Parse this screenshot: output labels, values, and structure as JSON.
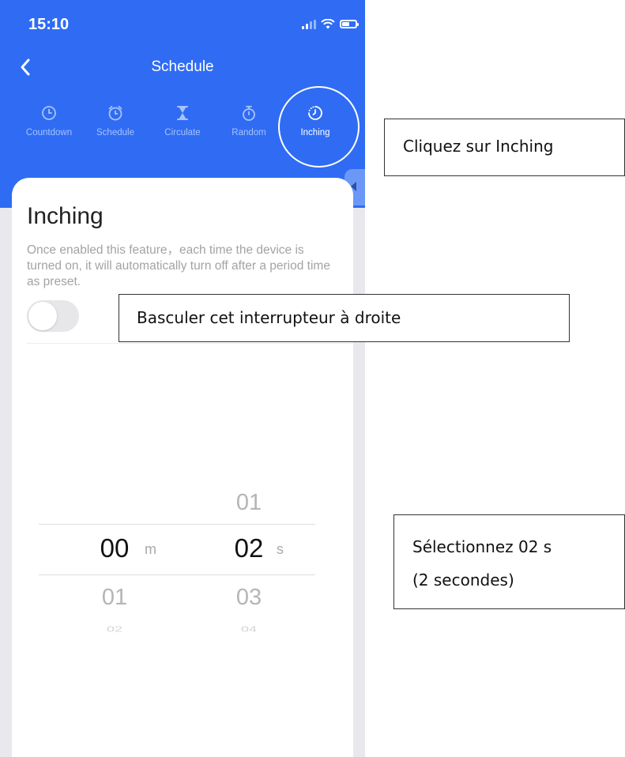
{
  "status_bar": {
    "time": "15:10",
    "signal_icon": "cellular-signal-icon",
    "wifi_icon": "wifi-icon",
    "battery_icon": "battery-icon",
    "battery_level": 0.55
  },
  "nav": {
    "back_icon": "chevron-left-icon",
    "title": "Schedule"
  },
  "tabs": [
    {
      "label": "Countdown",
      "icon": "clock-icon",
      "active": false
    },
    {
      "label": "Schedule",
      "icon": "alarm-clock-icon",
      "active": false
    },
    {
      "label": "Circulate",
      "icon": "hourglass-icon",
      "active": false
    },
    {
      "label": "Random",
      "icon": "stopwatch-icon",
      "active": false
    },
    {
      "label": "Inching",
      "icon": "dotted-timer-icon",
      "active": true
    }
  ],
  "card": {
    "title": "Inching",
    "description": "Once enabled this feature，each time the device is turned on, it will automatically turn off after a period time as preset.",
    "toggle_on": false
  },
  "picker": {
    "minutes": {
      "above": "",
      "selected": "00",
      "below": "01",
      "below2": "02",
      "unit": "m"
    },
    "seconds": {
      "above": "01",
      "selected": "02",
      "below": "03",
      "below2": "04",
      "unit": "s"
    }
  },
  "annotations": {
    "tab_callout": "Cliquez sur Inching",
    "toggle_callout": "Basculer cet interrupteur à droite",
    "picker_callout_line1": "Sélectionnez 02 s",
    "picker_callout_line2": "(2 secondes)"
  },
  "colors": {
    "header_blue": "#2f6cf3",
    "inactive_tab": "#a9c2fb",
    "background": "#e9e9ed"
  }
}
